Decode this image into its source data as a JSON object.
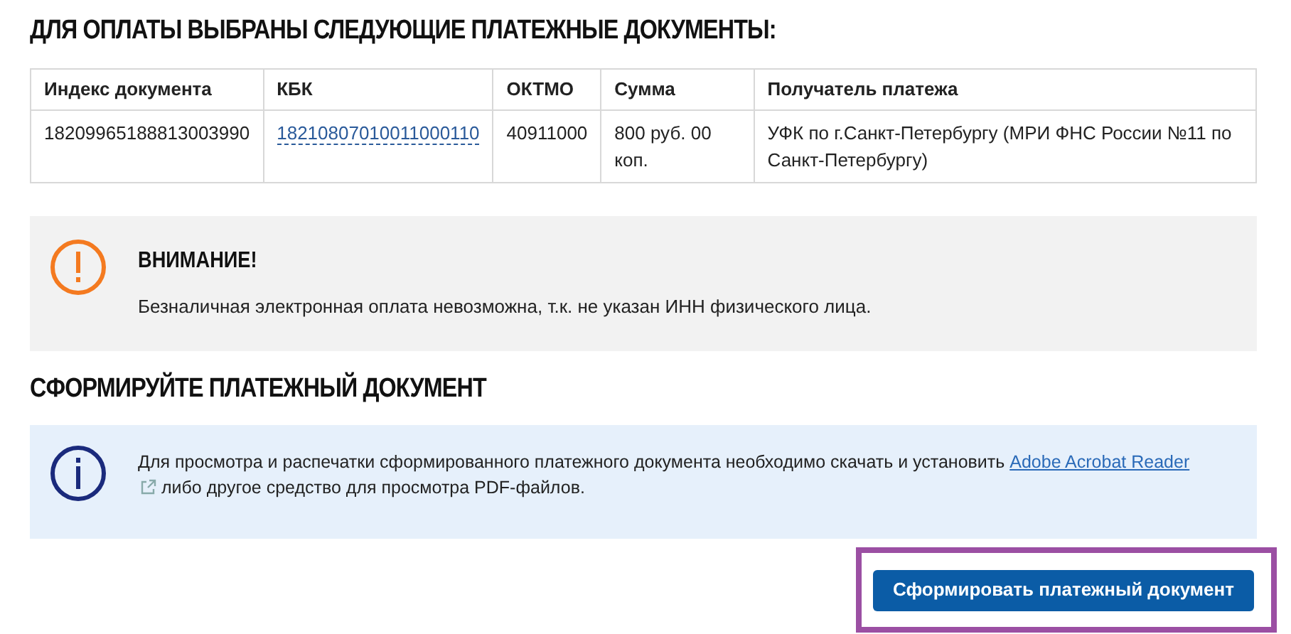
{
  "selected_heading": "ДЛЯ ОПЛАТЫ ВЫБРАНЫ СЛЕДУЮЩИЕ ПЛАТЕЖНЫЕ ДОКУМЕНТЫ:",
  "table": {
    "columns": [
      "Индекс документа",
      "КБК",
      "ОКТМО",
      "Сумма",
      "Получатель платежа"
    ],
    "rows": [
      [
        {
          "text": "18209965188813003990",
          "kind": "text"
        },
        {
          "text": "18210807010011000110",
          "kind": "link"
        },
        {
          "text": "40911000",
          "kind": "text"
        },
        {
          "text": "800 руб. 00 коп.",
          "kind": "text"
        },
        {
          "text": "УФК по г.Санкт-Петербургу (МРИ ФНС России №11 по Санкт-Петербургу)",
          "kind": "text"
        }
      ]
    ]
  },
  "warning": {
    "title": "ВНИМАНИЕ!",
    "text": "Безналичная электронная оплата невозможна, т.к. не указан ИНН физического лица."
  },
  "form_heading": "СФОРМИРУЙТЕ ПЛАТЕЖНЫЙ ДОКУМЕНТ",
  "info": {
    "text_before": "Для просмотра и распечатки сформированного платежного документа необходимо скачать и установить ",
    "link": "Adobe Acrobat Reader",
    "text_after": " либо другое средство для просмотра PDF-файлов."
  },
  "button": {
    "label": "Сформировать платежный документ",
    "highlighted": true
  }
}
